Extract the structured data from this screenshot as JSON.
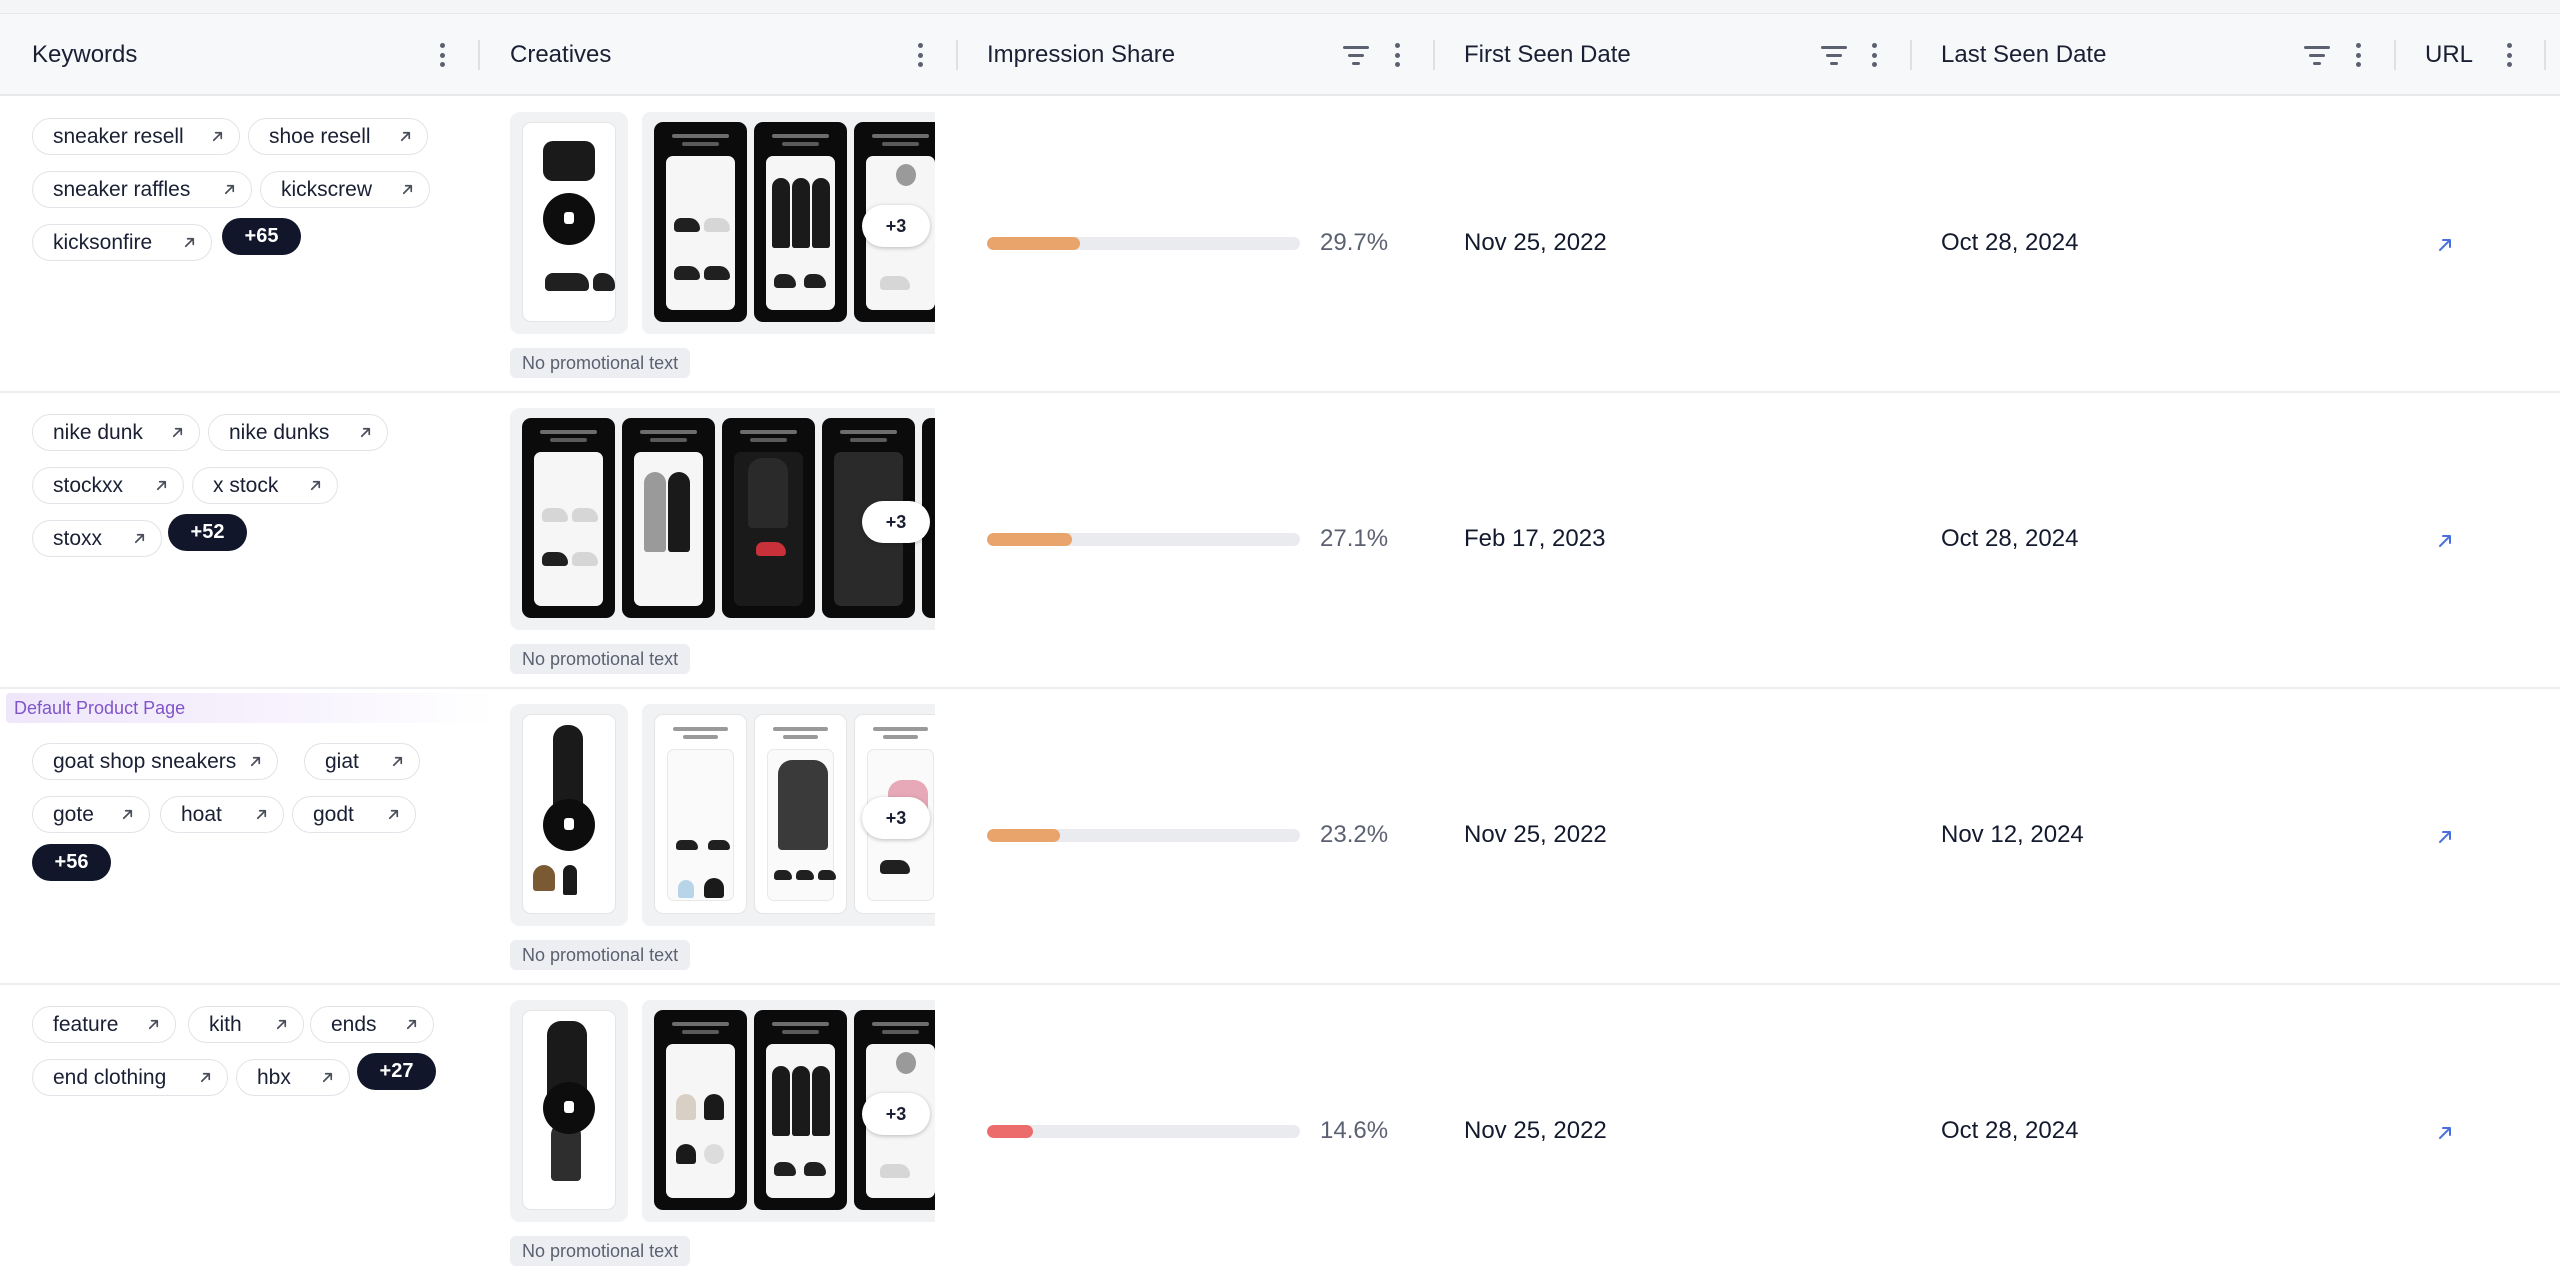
{
  "columns": {
    "keywords": "Keywords",
    "creatives": "Creatives",
    "impression_share": "Impression Share",
    "first_seen": "First Seen Date",
    "last_seen": "Last Seen Date",
    "url": "URL"
  },
  "rows": [
    {
      "keywords": [
        "sneaker resell",
        "shoe resell",
        "sneaker raffles",
        "kickscrew",
        "kicksonfire"
      ],
      "more_keywords": "+65",
      "creatives_more": "+3",
      "promo_text": "No promotional text",
      "impression_share": 29.7,
      "impression_share_label": "29.7%",
      "bar_color": "#e8a46b",
      "first_seen": "Nov 25, 2022",
      "last_seen": "Oct 28, 2024"
    },
    {
      "keywords": [
        "nike dunk",
        "nike dunks",
        "stockxx",
        "x stock",
        "stoxx"
      ],
      "more_keywords": "+52",
      "creatives_more": "+3",
      "promo_text": "No promotional text",
      "impression_share": 27.1,
      "impression_share_label": "27.1%",
      "bar_color": "#e8a46b",
      "first_seen": "Feb 17, 2023",
      "last_seen": "Oct 28, 2024"
    },
    {
      "badge": "Default Product Page",
      "keywords": [
        "goat shop sneakers",
        "giat",
        "gote",
        "hoat",
        "godt"
      ],
      "more_keywords": "+56",
      "creatives_more": "+3",
      "promo_text": "No promotional text",
      "impression_share": 23.2,
      "impression_share_label": "23.2%",
      "bar_color": "#e8a46b",
      "first_seen": "Nov 25, 2022",
      "last_seen": "Nov 12, 2024"
    },
    {
      "keywords": [
        "feature",
        "kith",
        "ends",
        "end clothing",
        "hbx"
      ],
      "more_keywords": "+27",
      "creatives_more": "+3",
      "promo_text": "No promotional text",
      "impression_share": 14.6,
      "impression_share_label": "14.6%",
      "bar_color": "#ec6b6b",
      "first_seen": "Nov 25, 2022",
      "last_seen": "Oct 28, 2024"
    }
  ],
  "icons": {
    "kebab": "more-vertical-icon",
    "filter": "filter-icon",
    "keyword_link": "arrow-up-right-icon",
    "url_link": "external-link-icon",
    "video": "play-icon"
  },
  "colors": {
    "accent_link": "#4c6fe0",
    "badge_text": "#7f55c9",
    "chip_more_bg": "#12162b"
  }
}
